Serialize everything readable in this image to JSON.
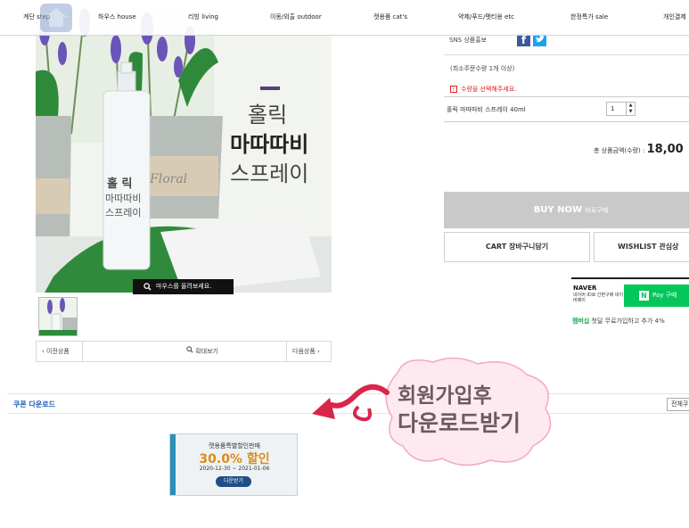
{
  "nav": {
    "items": [
      "계단 step",
      "하우스 house",
      "리빙 living",
      "이동/외출 outdoor",
      "캣용품 cat's",
      "약제/푸드/펫티용 etc",
      "한정특가 sale",
      "개인결제"
    ]
  },
  "gallery": {
    "product_title_lines": [
      "홀릭",
      "마따따비",
      "스프레이"
    ],
    "bottle_label_lines": [
      "홀 릭",
      "마따따비",
      "스프레이"
    ],
    "zoom_hint": "마우스를 올려보세요.",
    "prev": "이전상품",
    "enlarge": "확대보기",
    "next": "다음상품"
  },
  "detail": {
    "sns_label": "SNS 상품홍보",
    "min_order": "(최소주문수량 1개 이상)",
    "warning": "수량을 선택해주세요.",
    "warning_icon": "!",
    "item_name": "홀릭 마따따비 스프레이 40ml",
    "quantity": "1",
    "total_label": "총 상품금액(수량) :",
    "total_value": "18,00"
  },
  "buttons": {
    "buy_now": "BUY NOW",
    "buy_now_sub": "바로구매",
    "cart": "CART 장바구니담기",
    "wishlist": "WISHLIST 관심상"
  },
  "naver": {
    "logo": "NAVER",
    "sub": "네이버 ID로 간편구매 네이버페이",
    "pay": "Pay 구매",
    "pay_icon": "N"
  },
  "member": {
    "highlight": "멤버십",
    "text": " 첫달 무료가입하고 추가 4%"
  },
  "coupon": {
    "section_title": "쿠폰 다운로드",
    "view_all": "전체쿠",
    "name": "캣용품특별할인판매",
    "rate": "30.0% 할인",
    "period": "2020-12-30 ~ 2021-01-06",
    "download": "다운받기"
  },
  "sticker": {
    "line1": "회원가입후",
    "line2": "다운로드받기"
  },
  "colors": {
    "accent_blue": "#1a5fb4",
    "warn_red": "#e02020",
    "npay_green": "#03c75a",
    "coupon_orange": "#e08a18"
  }
}
